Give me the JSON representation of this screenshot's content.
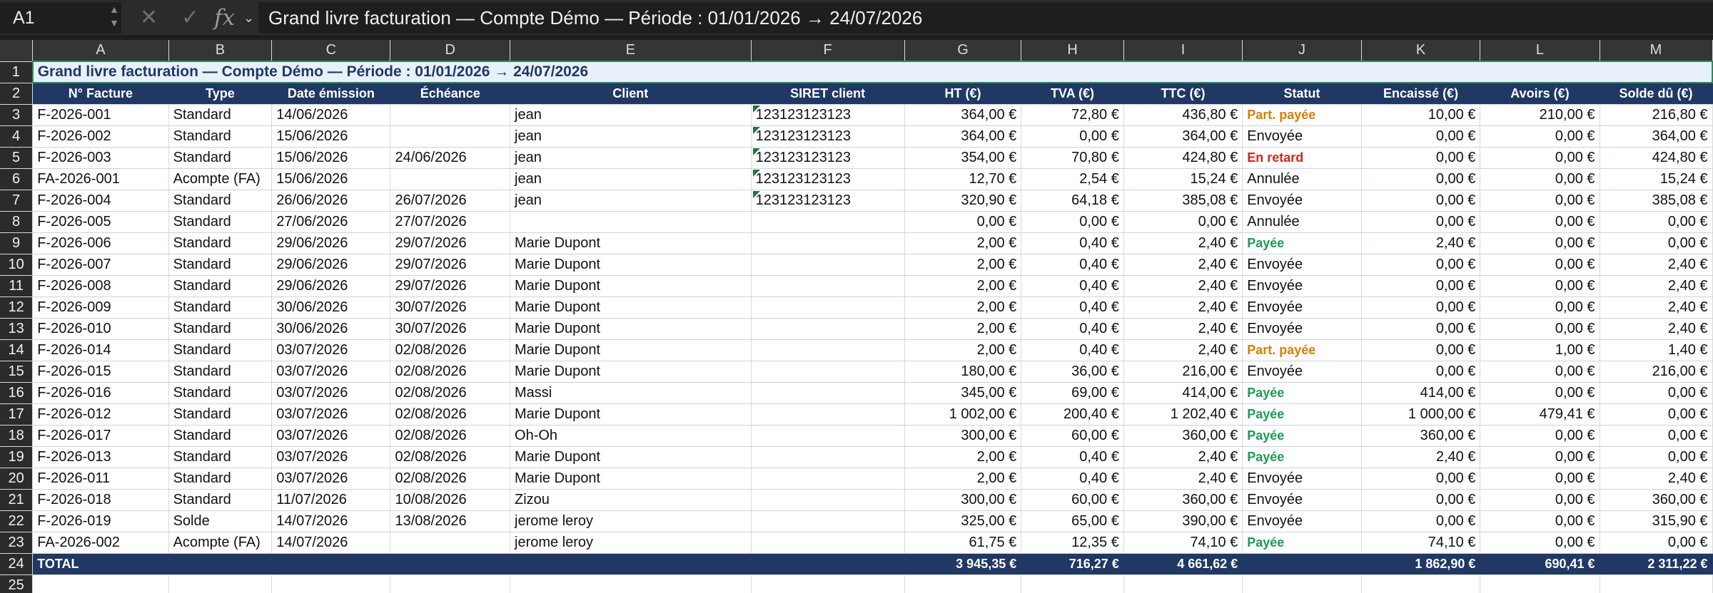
{
  "formula_bar": {
    "cell_ref": "A1",
    "formula": "Grand livre facturation — Compte Démo — Période : 01/01/2026 → 24/07/2026"
  },
  "columns": [
    "A",
    "B",
    "C",
    "D",
    "E",
    "F",
    "G",
    "H",
    "I",
    "J",
    "K",
    "L",
    "M"
  ],
  "title_row": {
    "row_num": "1",
    "text": "Grand livre facturation — Compte Démo — Période : 01/01/2026 → 24/07/2026"
  },
  "header_row": {
    "row_num": "2",
    "labels": [
      "N° Facture",
      "Type",
      "Date émission",
      "Échéance",
      "Client",
      "SIRET client",
      "HT (€)",
      "TVA (€)",
      "TTC (€)",
      "Statut",
      "Encaissé (€)",
      "Avoirs (€)",
      "Solde dû (€)"
    ]
  },
  "rows": [
    {
      "row_num": "3",
      "facture": "F-2026-001",
      "type": "Standard",
      "date": "14/06/2026",
      "echeance": "",
      "client": "jean",
      "siret": "123123123123",
      "ht": "364,00 €",
      "tva": "72,80 €",
      "ttc": "436,80 €",
      "statut": "Part. payée",
      "statut_kind": "partial",
      "encaisse": "10,00 €",
      "avoirs": "210,00 €",
      "solde": "216,80 €"
    },
    {
      "row_num": "4",
      "facture": "F-2026-002",
      "type": "Standard",
      "date": "15/06/2026",
      "echeance": "",
      "client": "jean",
      "siret": "123123123123",
      "ht": "364,00 €",
      "tva": "0,00 €",
      "ttc": "364,00 €",
      "statut": "Envoyée",
      "statut_kind": "normal",
      "encaisse": "0,00 €",
      "avoirs": "0,00 €",
      "solde": "364,00 €"
    },
    {
      "row_num": "5",
      "facture": "F-2026-003",
      "type": "Standard",
      "date": "15/06/2026",
      "echeance": "24/06/2026",
      "client": "jean",
      "siret": "123123123123",
      "ht": "354,00 €",
      "tva": "70,80 €",
      "ttc": "424,80 €",
      "statut": "En retard",
      "statut_kind": "late",
      "encaisse": "0,00 €",
      "avoirs": "0,00 €",
      "solde": "424,80 €"
    },
    {
      "row_num": "6",
      "facture": "FA-2026-001",
      "type": "Acompte (FA)",
      "date": "15/06/2026",
      "echeance": "",
      "client": "jean",
      "siret": "123123123123",
      "ht": "12,70 €",
      "tva": "2,54 €",
      "ttc": "15,24 €",
      "statut": "Annulée",
      "statut_kind": "normal",
      "encaisse": "0,00 €",
      "avoirs": "0,00 €",
      "solde": "15,24 €"
    },
    {
      "row_num": "7",
      "facture": "F-2026-004",
      "type": "Standard",
      "date": "26/06/2026",
      "echeance": "26/07/2026",
      "client": "jean",
      "siret": "123123123123",
      "ht": "320,90 €",
      "tva": "64,18 €",
      "ttc": "385,08 €",
      "statut": "Envoyée",
      "statut_kind": "normal",
      "encaisse": "0,00 €",
      "avoirs": "0,00 €",
      "solde": "385,08 €"
    },
    {
      "row_num": "8",
      "facture": "F-2026-005",
      "type": "Standard",
      "date": "27/06/2026",
      "echeance": "27/07/2026",
      "client": "",
      "siret": "",
      "ht": "0,00 €",
      "tva": "0,00 €",
      "ttc": "0,00 €",
      "statut": "Annulée",
      "statut_kind": "normal",
      "encaisse": "0,00 €",
      "avoirs": "0,00 €",
      "solde": "0,00 €"
    },
    {
      "row_num": "9",
      "facture": "F-2026-006",
      "type": "Standard",
      "date": "29/06/2026",
      "echeance": "29/07/2026",
      "client": "Marie Dupont",
      "siret": "",
      "ht": "2,00 €",
      "tva": "0,40 €",
      "ttc": "2,40 €",
      "statut": "Payée",
      "statut_kind": "paid",
      "encaisse": "2,40 €",
      "avoirs": "0,00 €",
      "solde": "0,00 €"
    },
    {
      "row_num": "10",
      "facture": "F-2026-007",
      "type": "Standard",
      "date": "29/06/2026",
      "echeance": "29/07/2026",
      "client": "Marie Dupont",
      "siret": "",
      "ht": "2,00 €",
      "tva": "0,40 €",
      "ttc": "2,40 €",
      "statut": "Envoyée",
      "statut_kind": "normal",
      "encaisse": "0,00 €",
      "avoirs": "0,00 €",
      "solde": "2,40 €"
    },
    {
      "row_num": "11",
      "facture": "F-2026-008",
      "type": "Standard",
      "date": "29/06/2026",
      "echeance": "29/07/2026",
      "client": "Marie Dupont",
      "siret": "",
      "ht": "2,00 €",
      "tva": "0,40 €",
      "ttc": "2,40 €",
      "statut": "Envoyée",
      "statut_kind": "normal",
      "encaisse": "0,00 €",
      "avoirs": "0,00 €",
      "solde": "2,40 €"
    },
    {
      "row_num": "12",
      "facture": "F-2026-009",
      "type": "Standard",
      "date": "30/06/2026",
      "echeance": "30/07/2026",
      "client": "Marie Dupont",
      "siret": "",
      "ht": "2,00 €",
      "tva": "0,40 €",
      "ttc": "2,40 €",
      "statut": "Envoyée",
      "statut_kind": "normal",
      "encaisse": "0,00 €",
      "avoirs": "0,00 €",
      "solde": "2,40 €"
    },
    {
      "row_num": "13",
      "facture": "F-2026-010",
      "type": "Standard",
      "date": "30/06/2026",
      "echeance": "30/07/2026",
      "client": "Marie Dupont",
      "siret": "",
      "ht": "2,00 €",
      "tva": "0,40 €",
      "ttc": "2,40 €",
      "statut": "Envoyée",
      "statut_kind": "normal",
      "encaisse": "0,00 €",
      "avoirs": "0,00 €",
      "solde": "2,40 €"
    },
    {
      "row_num": "14",
      "facture": "F-2026-014",
      "type": "Standard",
      "date": "03/07/2026",
      "echeance": "02/08/2026",
      "client": "Marie Dupont",
      "siret": "",
      "ht": "2,00 €",
      "tva": "0,40 €",
      "ttc": "2,40 €",
      "statut": "Part. payée",
      "statut_kind": "partial",
      "encaisse": "0,00 €",
      "avoirs": "1,00 €",
      "solde": "1,40 €"
    },
    {
      "row_num": "15",
      "facture": "F-2026-015",
      "type": "Standard",
      "date": "03/07/2026",
      "echeance": "02/08/2026",
      "client": "Marie Dupont",
      "siret": "",
      "ht": "180,00 €",
      "tva": "36,00 €",
      "ttc": "216,00 €",
      "statut": "Envoyée",
      "statut_kind": "normal",
      "encaisse": "0,00 €",
      "avoirs": "0,00 €",
      "solde": "216,00 €"
    },
    {
      "row_num": "16",
      "facture": "F-2026-016",
      "type": "Standard",
      "date": "03/07/2026",
      "echeance": "02/08/2026",
      "client": "Massi",
      "siret": "",
      "ht": "345,00 €",
      "tva": "69,00 €",
      "ttc": "414,00 €",
      "statut": "Payée",
      "statut_kind": "paid",
      "encaisse": "414,00 €",
      "avoirs": "0,00 €",
      "solde": "0,00 €"
    },
    {
      "row_num": "17",
      "facture": "F-2026-012",
      "type": "Standard",
      "date": "03/07/2026",
      "echeance": "02/08/2026",
      "client": "Marie Dupont",
      "siret": "",
      "ht": "1 002,00 €",
      "tva": "200,40 €",
      "ttc": "1 202,40 €",
      "statut": "Payée",
      "statut_kind": "paid",
      "encaisse": "1 000,00 €",
      "avoirs": "479,41 €",
      "solde": "0,00 €"
    },
    {
      "row_num": "18",
      "facture": "F-2026-017",
      "type": "Standard",
      "date": "03/07/2026",
      "echeance": "02/08/2026",
      "client": "Oh-Oh",
      "siret": "",
      "ht": "300,00 €",
      "tva": "60,00 €",
      "ttc": "360,00 €",
      "statut": "Payée",
      "statut_kind": "paid",
      "encaisse": "360,00 €",
      "avoirs": "0,00 €",
      "solde": "0,00 €"
    },
    {
      "row_num": "19",
      "facture": "F-2026-013",
      "type": "Standard",
      "date": "03/07/2026",
      "echeance": "02/08/2026",
      "client": "Marie Dupont",
      "siret": "",
      "ht": "2,00 €",
      "tva": "0,40 €",
      "ttc": "2,40 €",
      "statut": "Payée",
      "statut_kind": "paid",
      "encaisse": "2,40 €",
      "avoirs": "0,00 €",
      "solde": "0,00 €"
    },
    {
      "row_num": "20",
      "facture": "F-2026-011",
      "type": "Standard",
      "date": "03/07/2026",
      "echeance": "02/08/2026",
      "client": "Marie Dupont",
      "siret": "",
      "ht": "2,00 €",
      "tva": "0,40 €",
      "ttc": "2,40 €",
      "statut": "Envoyée",
      "statut_kind": "normal",
      "encaisse": "0,00 €",
      "avoirs": "0,00 €",
      "solde": "2,40 €"
    },
    {
      "row_num": "21",
      "facture": "F-2026-018",
      "type": "Standard",
      "date": "11/07/2026",
      "echeance": "10/08/2026",
      "client": "Zizou",
      "siret": "",
      "ht": "300,00 €",
      "tva": "60,00 €",
      "ttc": "360,00 €",
      "statut": "Envoyée",
      "statut_kind": "normal",
      "encaisse": "0,00 €",
      "avoirs": "0,00 €",
      "solde": "360,00 €"
    },
    {
      "row_num": "22",
      "facture": "F-2026-019",
      "type": "Solde",
      "date": "14/07/2026",
      "echeance": "13/08/2026",
      "client": "jerome leroy",
      "siret": "",
      "ht": "325,00 €",
      "tva": "65,00 €",
      "ttc": "390,00 €",
      "statut": "Envoyée",
      "statut_kind": "normal",
      "encaisse": "0,00 €",
      "avoirs": "0,00 €",
      "solde": "315,90 €"
    },
    {
      "row_num": "23",
      "facture": "FA-2026-002",
      "type": "Acompte (FA)",
      "date": "14/07/2026",
      "echeance": "",
      "client": "jerome leroy",
      "siret": "",
      "ht": "61,75 €",
      "tva": "12,35 €",
      "ttc": "74,10 €",
      "statut": "Payée",
      "statut_kind": "paid",
      "encaisse": "74,10 €",
      "avoirs": "0,00 €",
      "solde": "0,00 €"
    }
  ],
  "total_row": {
    "row_num": "24",
    "label": "TOTAL",
    "ht": "3 945,35 €",
    "tva": "716,27 €",
    "ttc": "4 661,62 €",
    "encaisse": "1 862,90 €",
    "avoirs": "690,41 €",
    "solde": "2 311,22 €"
  },
  "empty_row": {
    "row_num": "25"
  },
  "colors": {
    "header_bg": "#1f3864",
    "title_bg": "#e8f1fb",
    "partial": "#e07b00",
    "late": "#d8261c",
    "paid": "#1e9a55",
    "selection": "#2e8b57"
  }
}
